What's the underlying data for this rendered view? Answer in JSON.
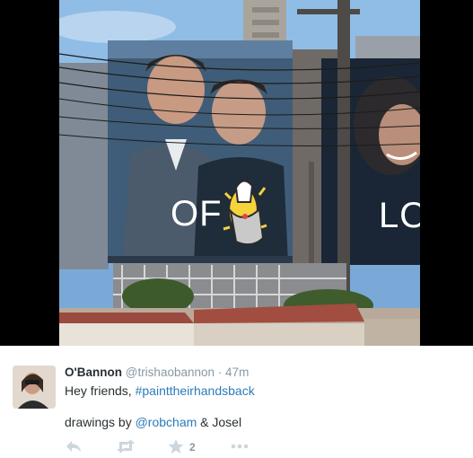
{
  "media": {
    "billboard_left_text": "OF",
    "billboard_right_text": "LO"
  },
  "tweet": {
    "display_name": "O'Bannon",
    "handle": "@trishaobannon",
    "separator": "·",
    "timestamp": "47m",
    "text_prefix": "Hey friends, ",
    "hashtag": "#painttheirhandsback",
    "credit_prefix": "drawings by ",
    "credit_mention": "@robcham",
    "credit_suffix": " & Josel",
    "favorite_count": "2"
  },
  "icons": {
    "reply": "reply-icon",
    "retweet": "retweet-icon",
    "favorite": "star-icon",
    "more": "more-icon"
  },
  "colors": {
    "link": "#2b7bb9",
    "muted": "#8899a6",
    "action_icon": "#ccd6dd",
    "text": "#292f33"
  }
}
